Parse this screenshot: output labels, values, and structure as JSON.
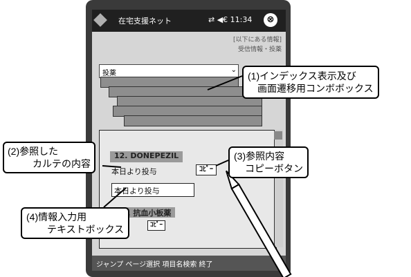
{
  "titlebar": {
    "title": "在宅支援ネット",
    "status": "⇄ ◀€ 11:34",
    "close": "⊗"
  },
  "header": {
    "line1": "[以下にある情報]",
    "line2": "受信情報・投薬"
  },
  "combo": {
    "selected": "投薬",
    "arrow": "⌄"
  },
  "content": {
    "item1_label": "12. DONEPEZIL",
    "item1_ref_text": "本日より投与",
    "copy_button": "ｺﾋﾟｰ",
    "input_value": "本日より投与",
    "item2_label": "13. 抗血小板薬",
    "copy_button2": "ｺﾋﾟｰ"
  },
  "bottombar": {
    "text": "ジャンプ ページ選択 項目名検索 終了"
  },
  "callouts": {
    "c1_line1": "(1)インデックス表示及び",
    "c1_line2": "画面遷移用コンボボックス",
    "c2_line1": "(2)参照した",
    "c2_line2": "カルテの内容",
    "c3_line1": "(3)参照内容",
    "c3_line2": "コピーボタン",
    "c4_line1": "(4)情報入力用",
    "c4_line2": "テキストボックス"
  }
}
